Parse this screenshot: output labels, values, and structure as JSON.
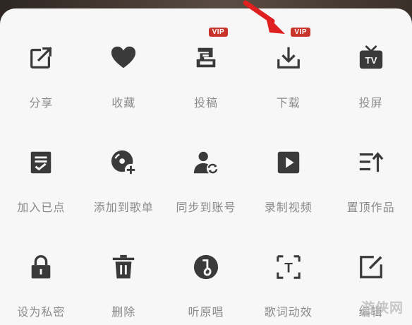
{
  "menu": {
    "items": [
      {
        "label": "分享",
        "icon": "share-icon"
      },
      {
        "label": "收藏",
        "icon": "heart-icon"
      },
      {
        "label": "投稿",
        "icon": "submit-icon",
        "badge": "VIP"
      },
      {
        "label": "下载",
        "icon": "download-icon",
        "badge": "VIP"
      },
      {
        "label": "投屏",
        "icon": "tv-cast-icon",
        "tv_text": "TV"
      },
      {
        "label": "加入已点",
        "icon": "queue-add-icon"
      },
      {
        "label": "添加到歌单",
        "icon": "playlist-add-icon"
      },
      {
        "label": "同步到账号",
        "icon": "account-sync-icon"
      },
      {
        "label": "录制视频",
        "icon": "record-video-icon"
      },
      {
        "label": "置顶作品",
        "icon": "pin-top-icon"
      },
      {
        "label": "设为私密",
        "icon": "lock-icon"
      },
      {
        "label": "删除",
        "icon": "trash-icon"
      },
      {
        "label": "听原唱",
        "icon": "original-song-icon"
      },
      {
        "label": "歌词动效",
        "icon": "lyric-effect-icon",
        "glyph": "T"
      },
      {
        "label": "编辑",
        "icon": "edit-icon"
      }
    ]
  },
  "watermark": "游侠网",
  "colors": {
    "icon": "#3a3a3a",
    "label": "#8a8a8a",
    "badge": "#c8332b",
    "sheet": "#f7f7f7"
  }
}
